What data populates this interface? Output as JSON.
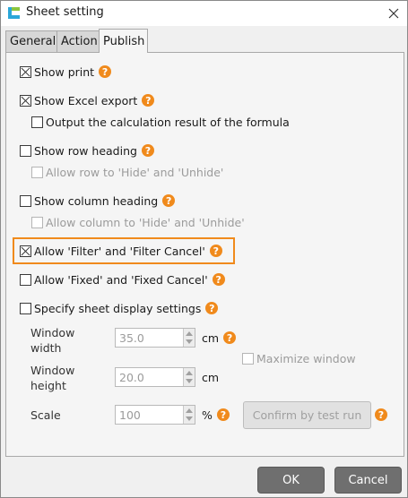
{
  "window": {
    "title": "Sheet setting",
    "icon": "app-logo-icon",
    "close_icon": "close-icon"
  },
  "tabs": [
    {
      "label": "General",
      "active": false
    },
    {
      "label": "Action",
      "active": false
    },
    {
      "label": "Publish",
      "active": true
    }
  ],
  "options": {
    "show_print": {
      "label": "Show print",
      "checked": true
    },
    "show_excel_export": {
      "label": "Show Excel export",
      "checked": true
    },
    "output_calc_result": {
      "label": "Output the calculation result of the formula",
      "checked": false
    },
    "show_row_heading": {
      "label": "Show row heading",
      "checked": false
    },
    "allow_row_hide": {
      "label": "Allow row to 'Hide' and 'Unhide'",
      "checked": false,
      "disabled": true
    },
    "show_column_heading": {
      "label": "Show column heading",
      "checked": false
    },
    "allow_column_hide": {
      "label": "Allow column to 'Hide' and 'Unhide'",
      "checked": false,
      "disabled": true
    },
    "allow_filter": {
      "label": "Allow 'Filter' and 'Filter Cancel'",
      "checked": true
    },
    "allow_fixed": {
      "label": "Allow 'Fixed' and 'Fixed Cancel'",
      "checked": false
    },
    "specify_display": {
      "label": "Specify sheet display settings",
      "checked": false
    }
  },
  "display_settings": {
    "window_width_label": "Window width",
    "window_width_value": "35.0",
    "window_width_unit": "cm",
    "window_height_label": "Window height",
    "window_height_value": "20.0",
    "window_height_unit": "cm",
    "scale_label": "Scale",
    "scale_value": "100",
    "scale_unit": "%",
    "maximize_window": {
      "label": "Maximize window",
      "checked": false,
      "disabled": true
    },
    "confirm_button": "Confirm by test run"
  },
  "footer": {
    "ok_label": "OK",
    "cancel_label": "Cancel"
  },
  "help_icon": "?",
  "colors": {
    "accent_orange": "#f08a1c",
    "button_gray": "#6f6f6f"
  }
}
